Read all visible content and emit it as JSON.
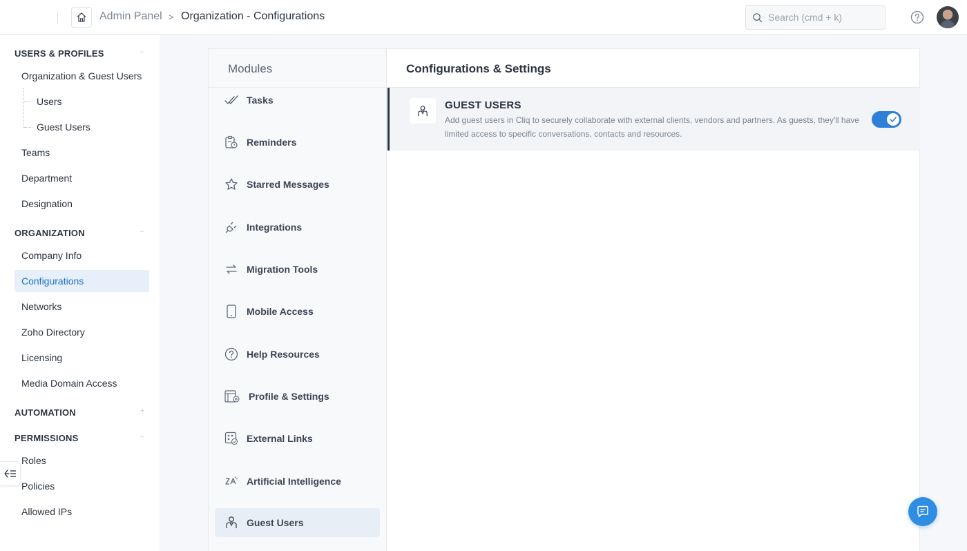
{
  "header": {
    "breadcrumb_root": "Admin Panel",
    "breadcrumb_sep": ">",
    "breadcrumb_current": "Organization - Configurations",
    "search_placeholder": "Search (cmd + k)"
  },
  "sidebar": {
    "sections": {
      "users_profiles": "USERS & PROFILES",
      "organization": "ORGANIZATION",
      "automation": "AUTOMATION",
      "permissions": "PERMISSIONS"
    },
    "items": {
      "org_guest_users": "Organization & Guest Users",
      "users": "Users",
      "guest_users": "Guest Users",
      "teams": "Teams",
      "department": "Department",
      "designation": "Designation",
      "company_info": "Company Info",
      "configurations": "Configurations",
      "networks": "Networks",
      "zoho_directory": "Zoho Directory",
      "licensing": "Licensing",
      "media_domain_access": "Media Domain Access",
      "roles": "Roles",
      "policies": "Policies",
      "allowed_ips": "Allowed IPs"
    }
  },
  "modules": {
    "title": "Modules",
    "items": [
      {
        "label": "Tasks",
        "icon": "tasks-icon"
      },
      {
        "label": "Reminders",
        "icon": "reminders-icon"
      },
      {
        "label": "Starred Messages",
        "icon": "star-icon"
      },
      {
        "label": "Integrations",
        "icon": "plug-icon"
      },
      {
        "label": "Migration Tools",
        "icon": "migration-arrows-icon"
      },
      {
        "label": "Mobile Access",
        "icon": "mobile-icon"
      },
      {
        "label": "Help Resources",
        "icon": "help-icon"
      },
      {
        "label": "Profile & Settings",
        "icon": "profile-settings-icon"
      },
      {
        "label": "External Links",
        "icon": "external-links-icon"
      },
      {
        "label": "Artificial Intelligence",
        "icon": "ai-icon"
      },
      {
        "label": "Guest Users",
        "icon": "guest-user-icon"
      }
    ]
  },
  "settings": {
    "title": "Configurations & Settings",
    "row": {
      "name": "GUEST USERS",
      "description": "Add guest users in Cliq to securely collaborate with external clients, vendors and partners. As guests, they'll have limited access to specific conversations, contacts and resources.",
      "enabled": true
    }
  },
  "colors": {
    "accent": "#2e7fd8",
    "active_nav_bg": "#e6effa",
    "active_nav_text": "#2172c5"
  }
}
